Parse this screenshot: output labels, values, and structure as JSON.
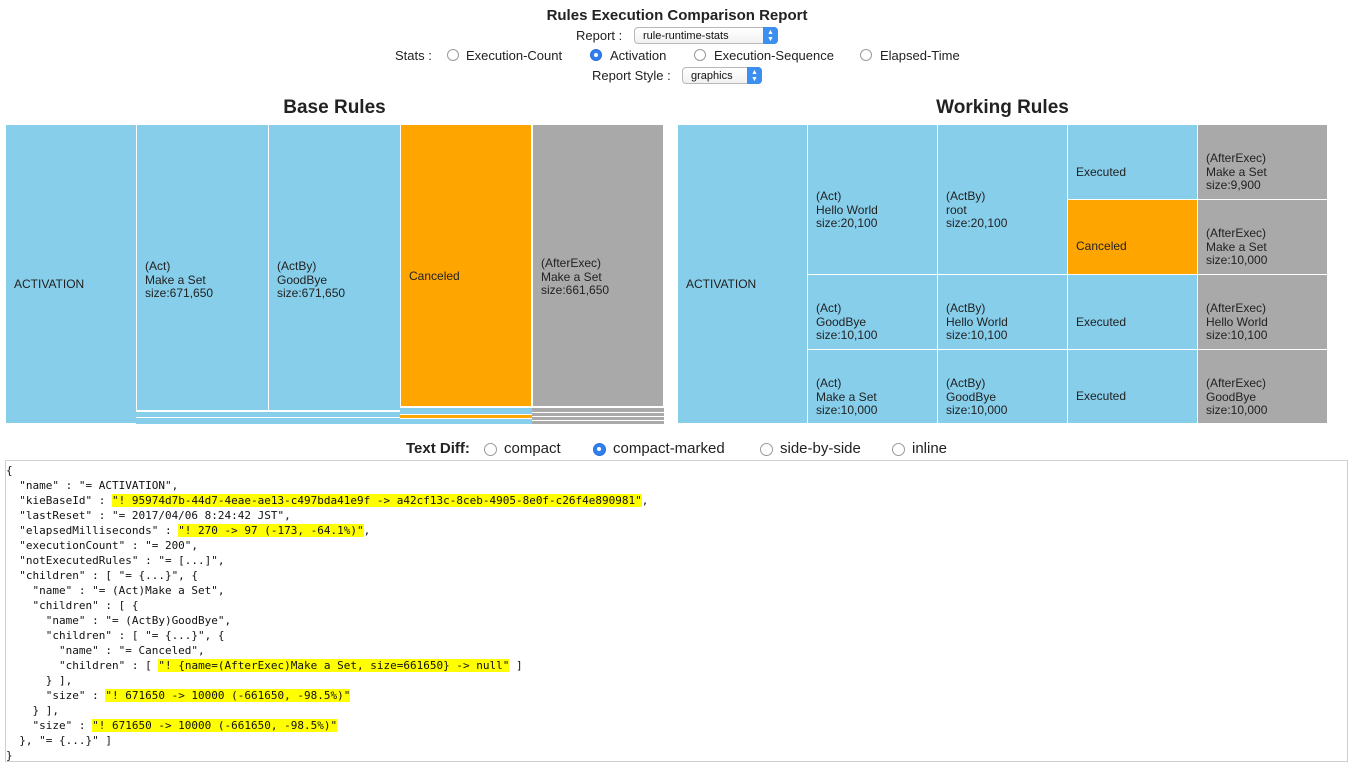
{
  "header": {
    "title": "Rules Execution Comparison Report",
    "report_label": "Report :",
    "report_value": "rule-runtime-stats",
    "stats_label": "Stats :",
    "stats_options": [
      "Execution-Count",
      "Activation",
      "Execution-Sequence",
      "Elapsed-Time"
    ],
    "stats_selected": "Activation",
    "style_label": "Report Style :",
    "style_value": "graphics"
  },
  "base": {
    "title": "Base Rules",
    "root": "ACTIVATION",
    "cells": [
      "(Act)\nMake a Set\nsize:671,650",
      "(ActBy)\nGoodBye\nsize:671,650",
      "Canceled",
      "(AfterExec)\nMake a Set\nsize:661,650"
    ]
  },
  "working": {
    "title": "Working Rules",
    "root": "ACTIVATION",
    "rows": [
      [
        "(Act)\nHello World\nsize:20,100",
        "(ActBy)\nroot\nsize:20,100",
        "Executed",
        "(AfterExec)\nMake a Set\nsize:9,900",
        "Canceled",
        "(AfterExec)\nMake a Set\nsize:10,000"
      ],
      [
        "(Act)\nGoodBye\nsize:10,100",
        "(ActBy)\nHello World\nsize:10,100",
        "Executed",
        "(AfterExec)\nHello World\nsize:10,100"
      ],
      [
        "(Act)\nMake a Set\nsize:10,000",
        "(ActBy)\nGoodBye\nsize:10,000",
        "Executed",
        "(AfterExec)\nGoodBye\nsize:10,000"
      ]
    ]
  },
  "text_diff": {
    "label": "Text Diff:",
    "options": [
      "compact",
      "compact-marked",
      "side-by-side",
      "inline"
    ],
    "selected": "compact-marked"
  },
  "diff_lines": [
    [
      {
        "t": "{"
      }
    ],
    [
      {
        "t": "  \"name\" : \"= ACTIVATION\","
      }
    ],
    [
      {
        "t": "  \"kieBaseId\" : "
      },
      {
        "t": "\"! 95974d7b-44d7-4eae-ae13-c497bda41e9f -> a42cf13c-8ceb-4905-8e0f-c26f4e890981\"",
        "h": true
      },
      {
        "t": ","
      }
    ],
    [
      {
        "t": "  \"lastReset\" : \"= 2017/04/06 8:24:42 JST\","
      }
    ],
    [
      {
        "t": "  \"elapsedMilliseconds\" : "
      },
      {
        "t": "\"! 270 -> 97 (-173, -64.1%)\"",
        "h": true
      },
      {
        "t": ","
      }
    ],
    [
      {
        "t": "  \"executionCount\" : \"= 200\","
      }
    ],
    [
      {
        "t": "  \"notExecutedRules\" : \"= [...]\","
      }
    ],
    [
      {
        "t": "  \"children\" : [ \"= {...}\", {"
      }
    ],
    [
      {
        "t": "    \"name\" : \"= (Act)Make a Set\","
      }
    ],
    [
      {
        "t": "    \"children\" : [ {"
      }
    ],
    [
      {
        "t": "      \"name\" : \"= (ActBy)GoodBye\","
      }
    ],
    [
      {
        "t": "      \"children\" : [ \"= {...}\", {"
      }
    ],
    [
      {
        "t": "        \"name\" : \"= Canceled\","
      }
    ],
    [
      {
        "t": "        \"children\" : [ "
      },
      {
        "t": "\"! {name=(AfterExec)Make a Set, size=661650} -> null\"",
        "h": true
      },
      {
        "t": " ]"
      }
    ],
    [
      {
        "t": "      } ],"
      }
    ],
    [
      {
        "t": "      \"size\" : "
      },
      {
        "t": "\"! 671650 -> 10000 (-661650, -98.5%)\"",
        "h": true
      }
    ],
    [
      {
        "t": "    } ],"
      }
    ],
    [
      {
        "t": "    \"size\" : "
      },
      {
        "t": "\"! 671650 -> 10000 (-661650, -98.5%)\"",
        "h": true
      }
    ],
    [
      {
        "t": "  }, \"= {...}\" ]"
      }
    ],
    [
      {
        "t": "}"
      }
    ]
  ],
  "colors": {
    "blue": "#87ceeb",
    "orange": "#ffa500",
    "grey": "#a9a9a9",
    "highlight": "#ffff00",
    "radio_selected": "#2f7ff0"
  }
}
